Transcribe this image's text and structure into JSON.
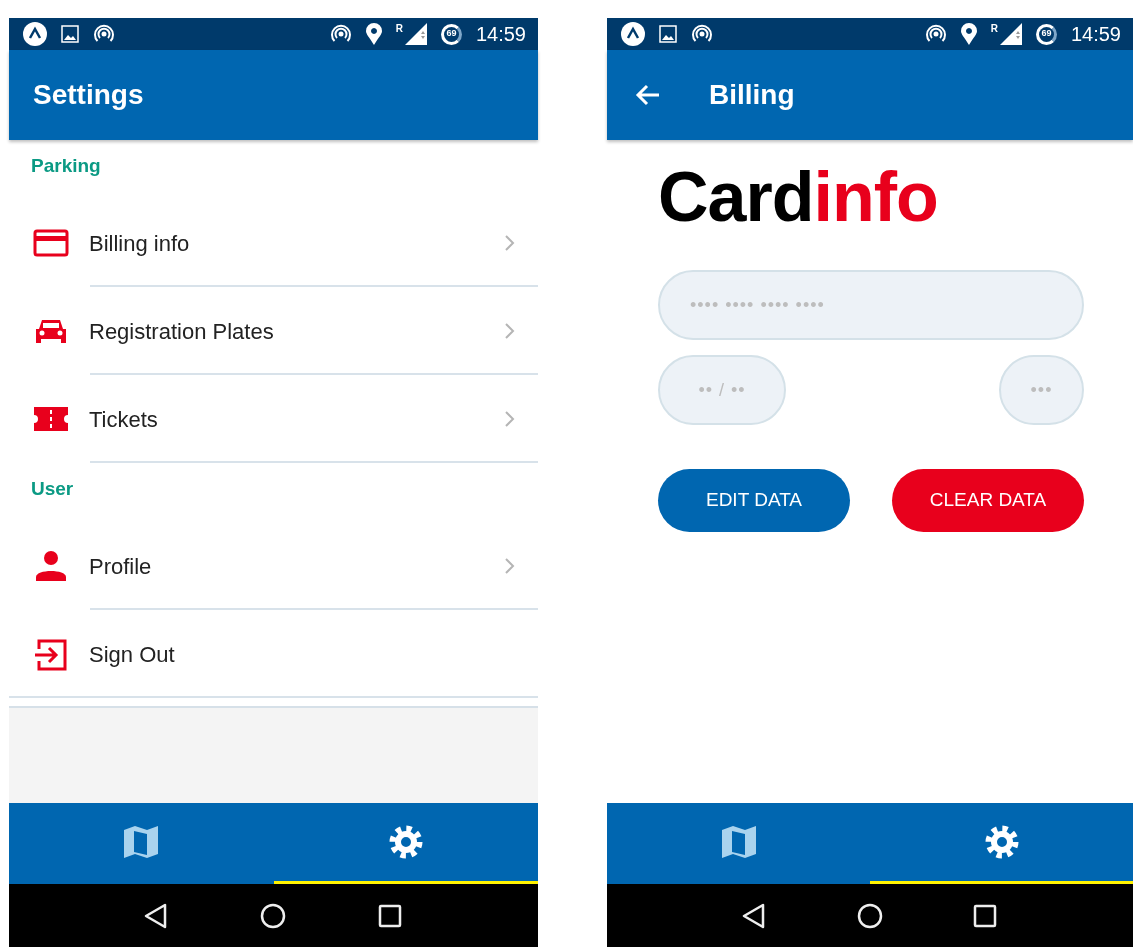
{
  "screens": [
    {
      "kind": "list",
      "status_bar": {
        "roaming": "R",
        "battery": "69",
        "time": "14:59"
      },
      "app_bar": {
        "title": "Settings",
        "back": false
      },
      "sections": [
        {
          "title": "Parking",
          "items": [
            {
              "label": "Billing info",
              "chevron": true
            },
            {
              "label": "Registration Plates",
              "chevron": true
            },
            {
              "label": "Tickets",
              "chevron": true
            }
          ]
        },
        {
          "title": "User",
          "items": [
            {
              "label": "Profile",
              "chevron": true
            },
            {
              "label": "Sign Out",
              "chevron": false
            }
          ]
        }
      ],
      "bottom_nav": [
        {
          "kind": "map",
          "selected": false
        },
        {
          "kind": "settings",
          "selected": true
        }
      ]
    },
    {
      "kind": "form",
      "status_bar": {
        "roaming": "R",
        "battery": "69",
        "time": "14:59"
      },
      "app_bar": {
        "title": "Billing",
        "back": true
      },
      "heading": [
        {
          "text": "Card",
          "color": "#000000"
        },
        {
          "text": "info",
          "color": "#e8001c"
        }
      ],
      "card_number": {
        "placeholder": "•••• •••• •••• ••••"
      },
      "expiry": {
        "placeholder": "•• / ••"
      },
      "cvc": {
        "placeholder": "•••"
      },
      "buttons": [
        {
          "label": "EDIT DATA",
          "color": "#0066b0"
        },
        {
          "label": "CLEAR DATA",
          "color": "#e8001c"
        }
      ],
      "bottom_nav": [
        {
          "kind": "map",
          "selected": false
        },
        {
          "kind": "settings",
          "selected": true
        }
      ]
    }
  ]
}
